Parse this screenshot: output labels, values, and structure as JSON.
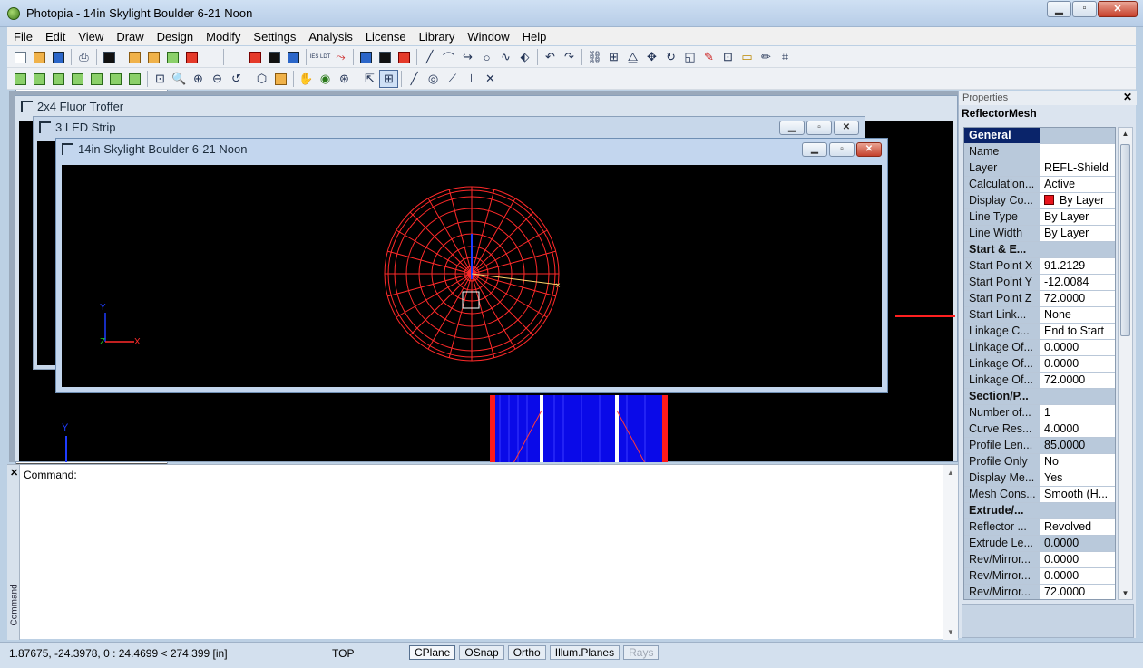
{
  "window": {
    "title": "Photopia - 14in Skylight Boulder 6-21 Noon"
  },
  "menu": [
    "File",
    "Edit",
    "View",
    "Draw",
    "Design",
    "Modify",
    "Settings",
    "Analysis",
    "License",
    "Library",
    "Window",
    "Help"
  ],
  "toolbar1": {
    "ies_ldt_label": "IES LDT"
  },
  "subwindows": [
    {
      "title": "2x4 Fluor Troffer"
    },
    {
      "title": "3 LED Strip"
    },
    {
      "title": "14in Skylight Boulder 6-21 Noon"
    }
  ],
  "viewport": {
    "axis_y": "Y",
    "axis_z": "Z",
    "axis_x": "X",
    "axis_y2": "Y",
    "colors": {
      "mesh": "#ff2a2a",
      "axis_blue": "#1e3cff",
      "axis_green": "#1fc31f",
      "marker": "#ffd36a"
    }
  },
  "properties": {
    "header": "Properties",
    "object": "ReflectorMesh",
    "rows": [
      {
        "name": "General",
        "value": "",
        "category": true,
        "selected": true
      },
      {
        "name": "Name",
        "value": ""
      },
      {
        "name": "Layer",
        "value": "REFL-Shield"
      },
      {
        "name": "Calculation...",
        "value": "Active"
      },
      {
        "name": "Display Co...",
        "value": "By Layer",
        "swatch": "#e8141c"
      },
      {
        "name": "Line Type",
        "value": "By Layer"
      },
      {
        "name": "Line Width",
        "value": "By Layer"
      },
      {
        "name": "Start & E...",
        "value": "",
        "category": true
      },
      {
        "name": "Start Point X",
        "value": "91.2129"
      },
      {
        "name": "Start Point Y",
        "value": "-12.0084"
      },
      {
        "name": "Start Point Z",
        "value": "72.0000"
      },
      {
        "name": "Start Link...",
        "value": "None"
      },
      {
        "name": "Linkage C...",
        "value": "End to Start"
      },
      {
        "name": "Linkage Of...",
        "value": "0.0000"
      },
      {
        "name": "Linkage Of...",
        "value": "0.0000"
      },
      {
        "name": "Linkage Of...",
        "value": "72.0000"
      },
      {
        "name": "Section/P...",
        "value": "",
        "category": true
      },
      {
        "name": "Number of...",
        "value": "1"
      },
      {
        "name": "Curve Res...",
        "value": "4.0000"
      },
      {
        "name": "Profile Len...",
        "value": "85.0000",
        "gray": true
      },
      {
        "name": "Profile Only",
        "value": "No"
      },
      {
        "name": "Display Me...",
        "value": "Yes"
      },
      {
        "name": "Mesh Cons...",
        "value": "Smooth (H..."
      },
      {
        "name": "Extrude/...",
        "value": "",
        "category": true
      },
      {
        "name": "Reflector ...",
        "value": "Revolved"
      },
      {
        "name": "Extrude Le...",
        "value": "0.0000",
        "gray": true
      },
      {
        "name": "Rev/Mirror...",
        "value": "0.0000"
      },
      {
        "name": "Rev/Mirror...",
        "value": "0.0000"
      },
      {
        "name": "Rev/Mirror...",
        "value": "72.0000"
      }
    ]
  },
  "command": {
    "label": "Command:",
    "side_label": "Command"
  },
  "status": {
    "coords": "1.87675, -24.3978, 0 : 24.4699 < 274.399 [in]",
    "view": "TOP",
    "buttons": [
      {
        "label": "CPlane",
        "state": "on"
      },
      {
        "label": "OSnap",
        "state": "normal"
      },
      {
        "label": "Ortho",
        "state": "normal"
      },
      {
        "label": "Illum.Planes",
        "state": "normal"
      },
      {
        "label": "Rays",
        "state": "disabled"
      }
    ]
  }
}
